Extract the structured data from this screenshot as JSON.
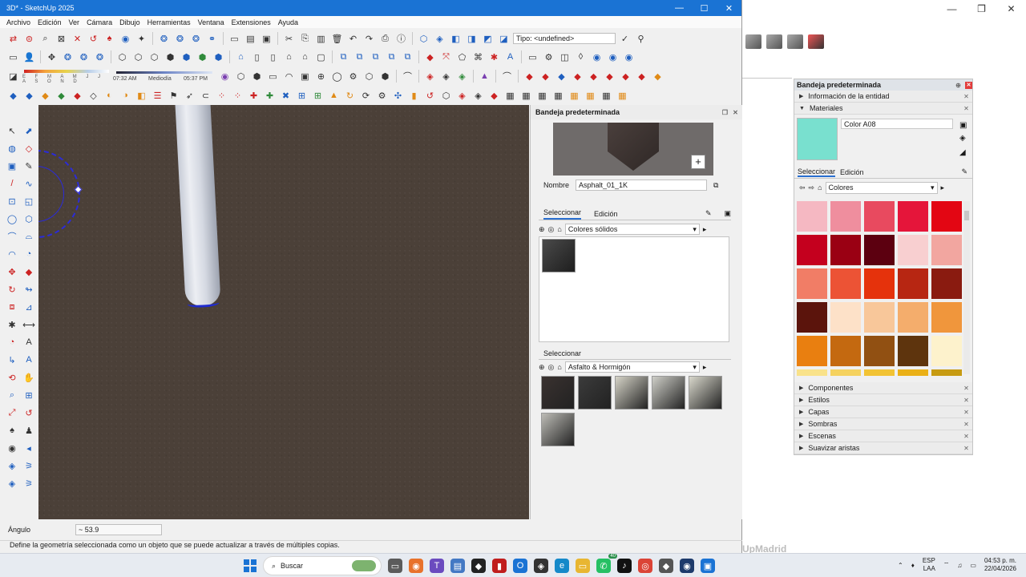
{
  "window": {
    "title": "3D* - SketchUp 2025",
    "caption_buttons": [
      "—",
      "☐",
      "✕"
    ]
  },
  "menu": [
    "Archivo",
    "Edición",
    "Ver",
    "Cámara",
    "Dibujo",
    "Herramientas",
    "Ventana",
    "Extensiones",
    "Ayuda"
  ],
  "toolbar": {
    "tipo_value": "Tipo: <undefined>",
    "shadow_letters": "E F M A M J J A S O N D",
    "time_start": "07:32 AM",
    "time_mid": "Mediodía",
    "time_end": "05:37 PM"
  },
  "viewport": {
    "pipe_color": "#dfe3ea",
    "ground_color": "#4b4038"
  },
  "floating_tray": {
    "title": "Bandeja predeterminada",
    "name_label": "Nombre",
    "name_value": "Asphalt_01_1K",
    "tab_select": "Seleccionar",
    "tab_edit": "Edición",
    "collection1": "Colores sólidos",
    "select_label": "Seleccionar",
    "collection2": "Asfalto & Hormigón",
    "asphalt_thumbs": [
      "#3a3230",
      "#3b3b3b",
      "#d6d4c8",
      "#cfcfc8",
      "#d9d8cc",
      "#bdbcb6"
    ]
  },
  "right_tray": {
    "title": "Bandeja predeterminada",
    "entity_info": "Información de la entidad",
    "materials": "Materiales",
    "material_name": "Color A08",
    "material_color": "#79e0cf",
    "tab_select": "Seleccionar",
    "tab_edit": "Edición",
    "collection": "Colores",
    "swatches": [
      "#f5b8c2",
      "#ef8e9e",
      "#e84a5f",
      "#e5153a",
      "#e30613",
      "#c4001e",
      "#9a0013",
      "#5c0010",
      "#f8cfd0",
      "#f2a6a0",
      "#f17d66",
      "#ec5335",
      "#e5320c",
      "#b72612",
      "#8a1b10",
      "#5b140c",
      "#fde1c8",
      "#f8c79a",
      "#f4ad6c",
      "#f0963c",
      "#e97f10",
      "#c46910",
      "#915012",
      "#5e340d",
      "#fdf2cc",
      "#f9e28a",
      "#f5d25f",
      "#f2c334",
      "#eab017",
      "#c79b12"
    ],
    "sections": [
      "Componentes",
      "Estilos",
      "Capas",
      "Sombras",
      "Escenas",
      "Suavizar aristas"
    ]
  },
  "status": {
    "measure_label": "Ángulo",
    "measure_value": "~ 53.9",
    "hint": "Define la geometría seleccionada como un objeto que se puede actualizar a través de múltiples copias."
  },
  "background": {
    "watermark": "UpMadrid"
  },
  "taskbar": {
    "search_placeholder": "Buscar",
    "lang": "ESP",
    "lang2": "LAA",
    "time": "04:53 p. m.",
    "date": "22/04/2026",
    "badge": "40"
  }
}
